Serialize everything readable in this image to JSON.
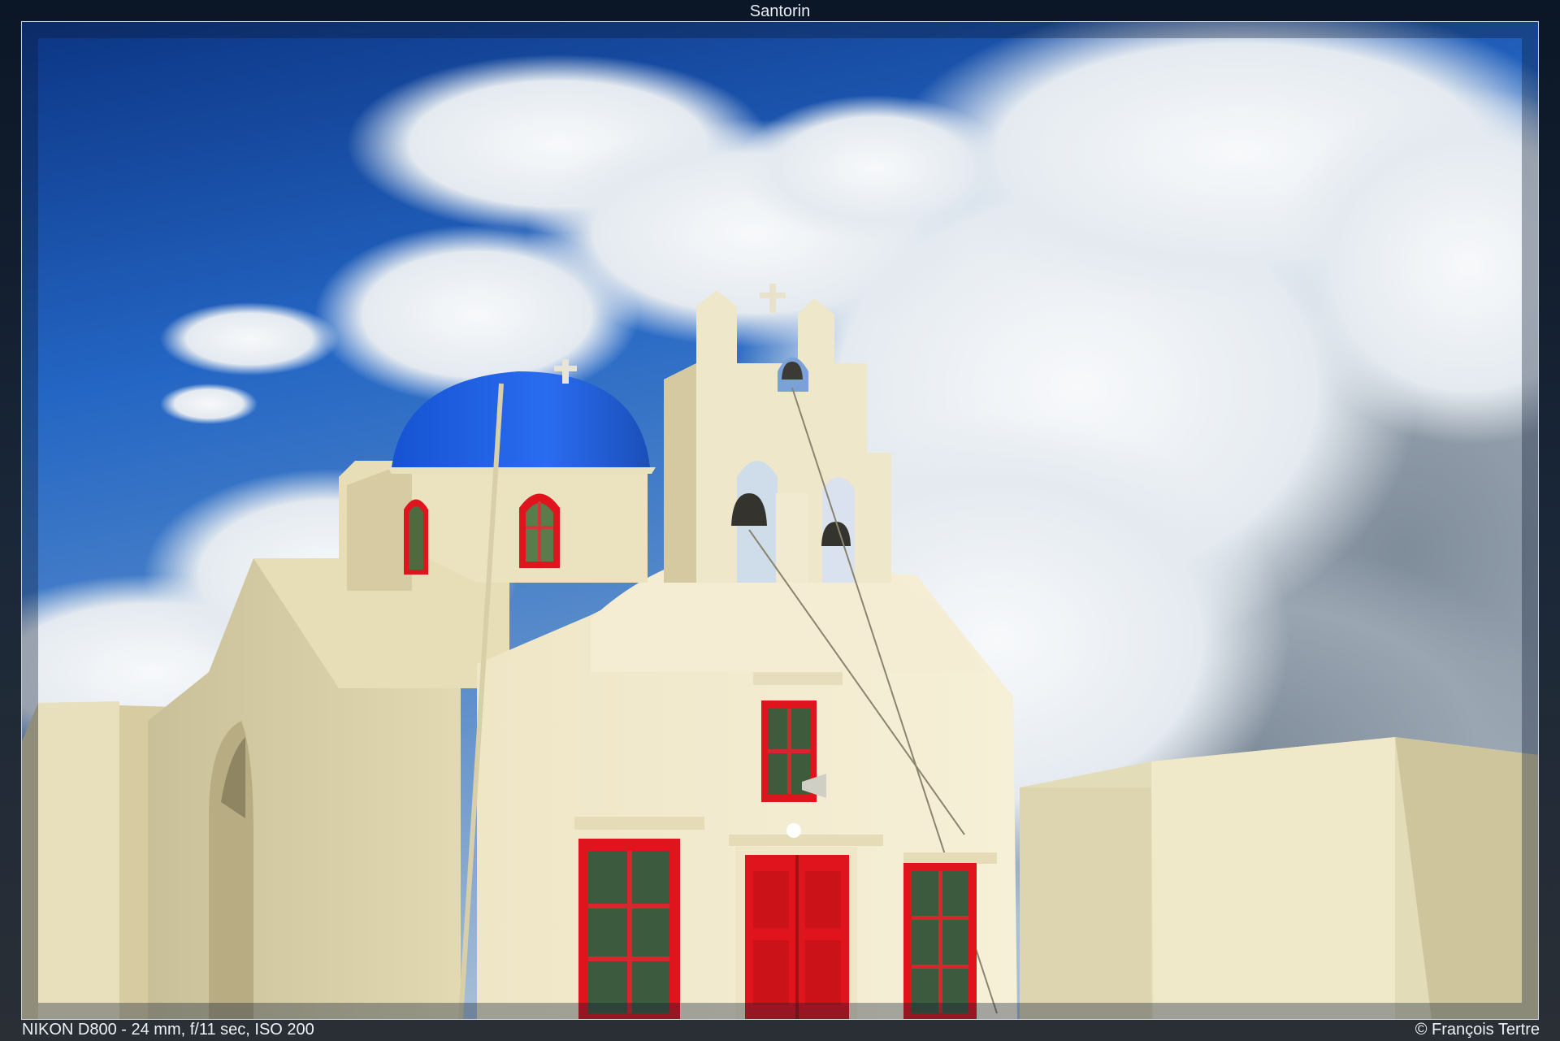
{
  "title": "Santorin",
  "exif": "NIKON D800 - 24 mm, f/11 sec, ISO 200",
  "copyright": "© François Tertre",
  "photo": {
    "subject": "whitewashed church with blue dome and bell tower",
    "colors": {
      "sky_top": "#0f3d92",
      "sky_mid": "#2f6fc8",
      "cloud": "#eef2f5",
      "cloud_shadow": "#8d9aa7",
      "wall": "#f1ead0",
      "wall_shade": "#d9cfa8",
      "dome": "#1e5fe0",
      "door": "#e0141c",
      "window_glass": "#3b6b46"
    }
  }
}
